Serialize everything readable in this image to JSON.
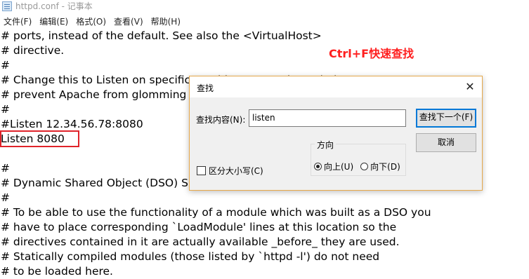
{
  "window": {
    "title": "httpd.conf - 记事本"
  },
  "menu": [
    "文件(F)",
    "编辑(E)",
    "格式(O)",
    "查看(V)",
    "帮助(H)"
  ],
  "editor": {
    "lines": [
      "# ports, instead of the default. See also the <VirtualHost>",
      "# directive.",
      "#",
      "# Change this to Listen on specific IP addresses as shown below to",
      "# prevent Apache from glomming onto all bound IP addresses.",
      "#",
      "#Listen 12.34.56.78:8080",
      "Listen 8080",
      "",
      "#",
      "# Dynamic Shared Object (DSO) Support",
      "#",
      "# To be able to use the functionality of a module which was built as a DSO you",
      "# have to place corresponding `LoadModule' lines at this location so the",
      "# directives contained in it are actually available _before_ they are used.",
      "# Statically compiled modules (those listed by `httpd -l') do not need",
      "# to be loaded here."
    ]
  },
  "annotation": {
    "text": "Ctrl+F快速查找",
    "color": "#ff1f1f"
  },
  "find_dialog": {
    "title": "查找",
    "find_label": "查找内容(N):",
    "find_value": "listen",
    "find_next_label": "查找下一个(F)",
    "cancel_label": "取消",
    "match_case_label": "区分大小写(C)",
    "match_case_checked": false,
    "direction_label": "方向",
    "direction_up_label": "向上(U)",
    "direction_down_label": "向下(D)",
    "direction_selected": "up",
    "accent_color": "#0078d7"
  }
}
